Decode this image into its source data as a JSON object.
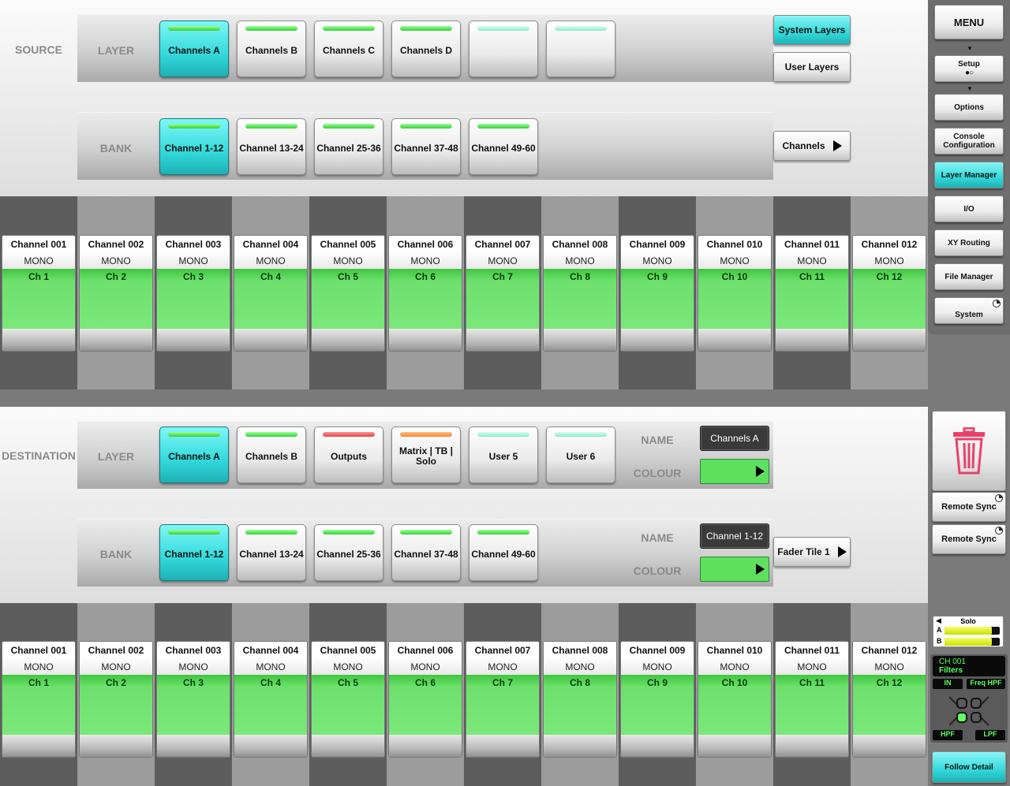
{
  "source": {
    "label": "SOURCE",
    "layer_label": "LAYER",
    "bank_label": "BANK",
    "layers": [
      {
        "label": "Channels A",
        "led": "green",
        "selected": true
      },
      {
        "label": "Channels B",
        "led": "green",
        "selected": false
      },
      {
        "label": "Channels C",
        "led": "green",
        "selected": false
      },
      {
        "label": "Channels D",
        "led": "green",
        "selected": false
      },
      {
        "label": "",
        "led": "mint",
        "selected": false
      },
      {
        "label": "",
        "led": "mint",
        "selected": false
      }
    ],
    "banks": [
      {
        "label": "Channel 1-12",
        "selected": true
      },
      {
        "label": "Channel 13-24",
        "selected": false
      },
      {
        "label": "Channel 25-36",
        "selected": false
      },
      {
        "label": "Channel 37-48",
        "selected": false
      },
      {
        "label": "Channel 49-60",
        "selected": false
      }
    ],
    "system_layers_label": "System Layers",
    "user_layers_label": "User Layers",
    "channels_button_label": "Channels",
    "strips": [
      {
        "name": "Channel 001",
        "mode": "MONO",
        "ch": "Ch 1"
      },
      {
        "name": "Channel 002",
        "mode": "MONO",
        "ch": "Ch 2"
      },
      {
        "name": "Channel 003",
        "mode": "MONO",
        "ch": "Ch 3"
      },
      {
        "name": "Channel 004",
        "mode": "MONO",
        "ch": "Ch 4"
      },
      {
        "name": "Channel 005",
        "mode": "MONO",
        "ch": "Ch 5"
      },
      {
        "name": "Channel 006",
        "mode": "MONO",
        "ch": "Ch 6"
      },
      {
        "name": "Channel 007",
        "mode": "MONO",
        "ch": "Ch 7"
      },
      {
        "name": "Channel 008",
        "mode": "MONO",
        "ch": "Ch 8"
      },
      {
        "name": "Channel 009",
        "mode": "MONO",
        "ch": "Ch 9"
      },
      {
        "name": "Channel 010",
        "mode": "MONO",
        "ch": "Ch 10"
      },
      {
        "name": "Channel 011",
        "mode": "MONO",
        "ch": "Ch 11"
      },
      {
        "name": "Channel 012",
        "mode": "MONO",
        "ch": "Ch 12"
      }
    ]
  },
  "destination": {
    "label": "DESTINATION",
    "layer_label": "LAYER",
    "bank_label": "BANK",
    "layers": [
      {
        "label": "Channels A",
        "led": "green",
        "selected": true
      },
      {
        "label": "Channels B",
        "led": "green",
        "selected": false
      },
      {
        "label": "Outputs",
        "led": "red",
        "selected": false
      },
      {
        "label": "Matrix | TB | Solo",
        "led": "orange",
        "selected": false
      },
      {
        "label": "User 5",
        "led": "mint",
        "selected": false
      },
      {
        "label": "User 6",
        "led": "mint",
        "selected": false
      }
    ],
    "banks": [
      {
        "label": "Channel 1-12",
        "selected": true
      },
      {
        "label": "Channel 13-24",
        "selected": false
      },
      {
        "label": "Channel 25-36",
        "selected": false
      },
      {
        "label": "Channel 37-48",
        "selected": false
      },
      {
        "label": "Channel 49-60",
        "selected": false
      }
    ],
    "layer_name_label": "NAME",
    "layer_name_value": "Channels A",
    "layer_colour_label": "COLOUR",
    "bank_name_label": "NAME",
    "bank_name_value": "Channel 1-12",
    "bank_colour_label": "COLOUR",
    "fader_tile_label": "Fader Tile 1",
    "strips": [
      {
        "name": "Channel 001",
        "mode": "MONO",
        "ch": "Ch 1"
      },
      {
        "name": "Channel 002",
        "mode": "MONO",
        "ch": "Ch 2"
      },
      {
        "name": "Channel 003",
        "mode": "MONO",
        "ch": "Ch 3"
      },
      {
        "name": "Channel 004",
        "mode": "MONO",
        "ch": "Ch 4"
      },
      {
        "name": "Channel 005",
        "mode": "MONO",
        "ch": "Ch 5"
      },
      {
        "name": "Channel 006",
        "mode": "MONO",
        "ch": "Ch 6"
      },
      {
        "name": "Channel 007",
        "mode": "MONO",
        "ch": "Ch 7"
      },
      {
        "name": "Channel 008",
        "mode": "MONO",
        "ch": "Ch 8"
      },
      {
        "name": "Channel 009",
        "mode": "MONO",
        "ch": "Ch 9"
      },
      {
        "name": "Channel 010",
        "mode": "MONO",
        "ch": "Ch 10"
      },
      {
        "name": "Channel 011",
        "mode": "MONO",
        "ch": "Ch 11"
      },
      {
        "name": "Channel 012",
        "mode": "MONO",
        "ch": "Ch 12"
      }
    ]
  },
  "menu": {
    "title": "MENU",
    "items": [
      {
        "label": "Setup",
        "selected": false
      },
      {
        "label": "Options",
        "selected": false
      },
      {
        "label": "Console Configuration",
        "selected": false
      },
      {
        "label": "Layer Manager",
        "selected": true
      },
      {
        "label": "I/O",
        "selected": false
      },
      {
        "label": "XY Routing",
        "selected": false
      },
      {
        "label": "File Manager",
        "selected": false
      },
      {
        "label": "System",
        "selected": false
      }
    ]
  },
  "actions": {
    "delete_icon": "trash-icon",
    "remote_sync_1": "Remote Sync",
    "remote_sync_2": "Remote Sync"
  },
  "meter": {
    "title": "Solo",
    "a_label": "A",
    "b_label": "B",
    "a_level": 0.85,
    "b_level": 0.85
  },
  "filters": {
    "channel": "CH 001",
    "title": "Filters",
    "in_label": "IN",
    "freq_label": "Freq HPF",
    "hpf_label": "HPF",
    "lpf_label": "LPF"
  },
  "follow_detail_label": "Follow Detail",
  "colors": {
    "accent": "#32d9db",
    "strip_green": "#6ee06e",
    "led_green": "#35d135",
    "led_red": "#e04848",
    "led_orange": "#f08a3a"
  }
}
